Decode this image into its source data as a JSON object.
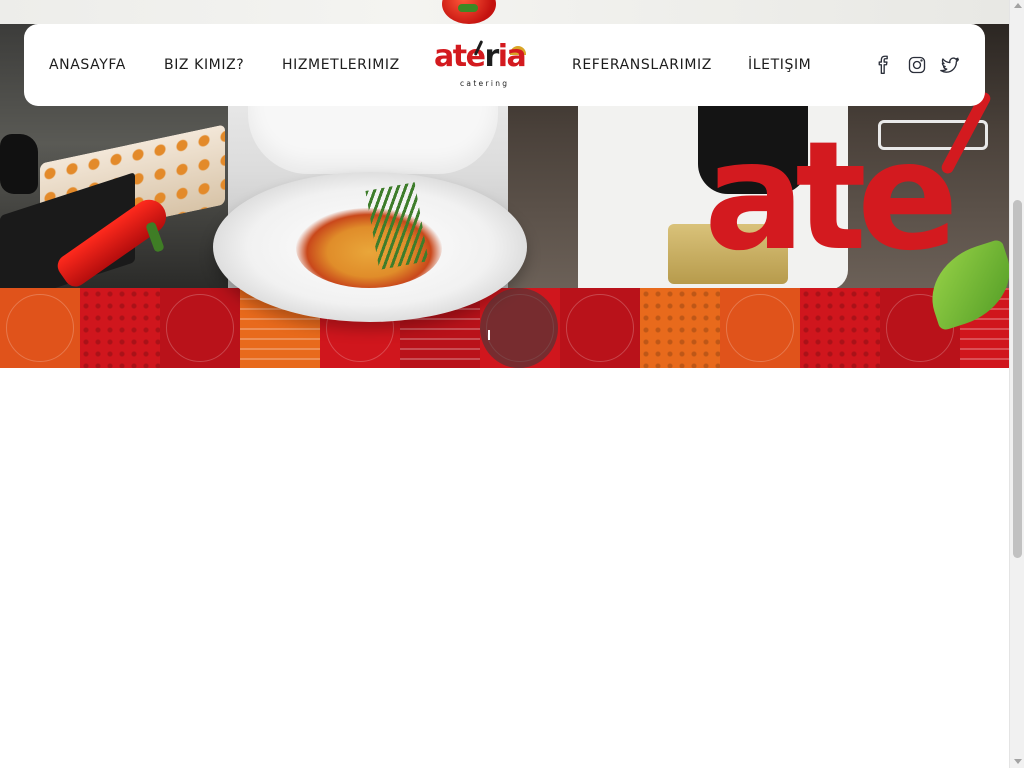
{
  "nav": {
    "links_left": [
      {
        "label": "ANASAYFA"
      },
      {
        "label": "BIZ KIMIZ?"
      },
      {
        "label": "HIZMETLERIMIZ"
      }
    ],
    "links_right": [
      {
        "label": "REFERANSLARIMIZ"
      },
      {
        "label": "İLETIŞIM"
      }
    ],
    "logo": {
      "word_red": "ate",
      "word_dark": "r",
      "word_red2": "ia",
      "sub": "catering"
    },
    "social": [
      {
        "icon": "facebook-icon"
      },
      {
        "icon": "instagram-icon"
      },
      {
        "icon": "twitter-icon"
      }
    ]
  },
  "hero": {
    "brand_text": "ate"
  },
  "colors": {
    "brand_red": "#d31a1f",
    "nav_text": "#1d1d1d",
    "gold": "#d9a526"
  }
}
